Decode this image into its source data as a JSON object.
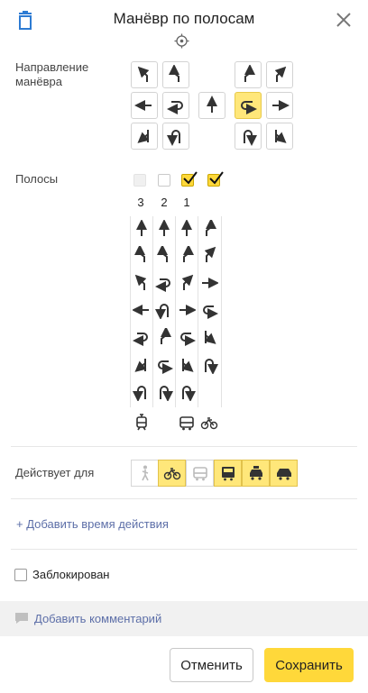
{
  "header": {
    "title": "Манёвр по полосам"
  },
  "direction": {
    "label": "Направление манёвра"
  },
  "lanes": {
    "label": "Полосы",
    "numbers": [
      "3",
      "2",
      "1"
    ]
  },
  "applies_for": {
    "label": "Действует для",
    "vehicles": [
      {
        "icon": "pedestrian-icon",
        "selected": false
      },
      {
        "icon": "bicycle-icon",
        "selected": true
      },
      {
        "icon": "bus-icon",
        "selected": false
      },
      {
        "icon": "truck-icon",
        "selected": true
      },
      {
        "icon": "taxi-icon",
        "selected": true
      },
      {
        "icon": "car-icon",
        "selected": true
      }
    ]
  },
  "add_time": {
    "label": "+ Добавить время действия"
  },
  "blocked": {
    "label": "Заблокирован",
    "checked": false
  },
  "comment": {
    "label": "Добавить комментарий"
  },
  "footer": {
    "cancel_label": "Отменить",
    "save_label": "Сохранить"
  },
  "colors": {
    "accent": "#ffd83a",
    "selected_bg": "#ffe77a",
    "link": "#5d6fa8"
  }
}
